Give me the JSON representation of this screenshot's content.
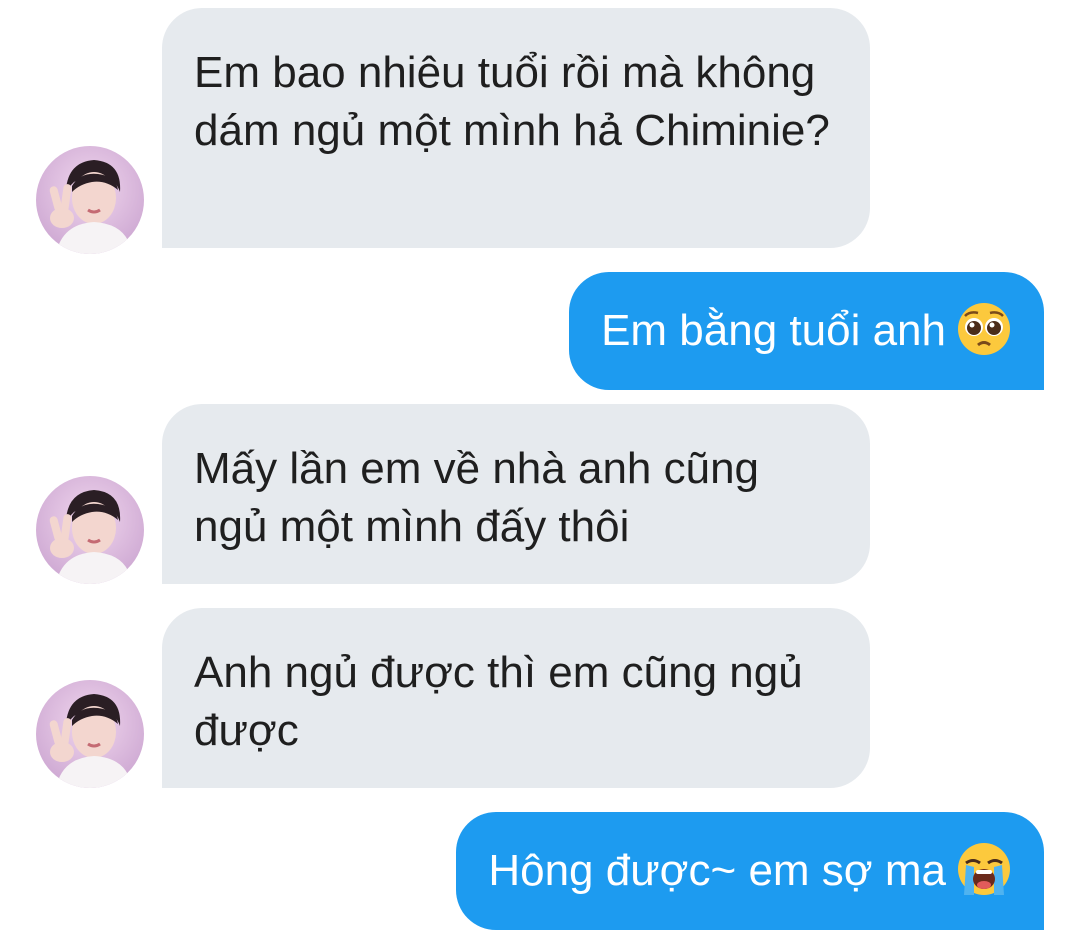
{
  "messages": [
    {
      "side": "in",
      "text": "Em bao nhiêu tuổi rồi mà không dám ngủ một mình hả Chiminie?"
    },
    {
      "side": "out",
      "text": "Em bằng tuổi anh",
      "emoji": "pleading-face-icon"
    },
    {
      "side": "in",
      "text": "Mấy lần em về nhà anh cũng ngủ một mình đấy thôi"
    },
    {
      "side": "in",
      "text": "Anh ngủ được thì em cũng ngủ được"
    },
    {
      "side": "out",
      "text": "Hông được~ em sợ ma",
      "emoji": "loudly-crying-face-icon"
    }
  ],
  "colors": {
    "incoming_bubble": "#e6eaee",
    "outgoing_bubble": "#1d9bf0",
    "incoming_text": "#1f1f1f",
    "outgoing_text": "#ffffff"
  }
}
